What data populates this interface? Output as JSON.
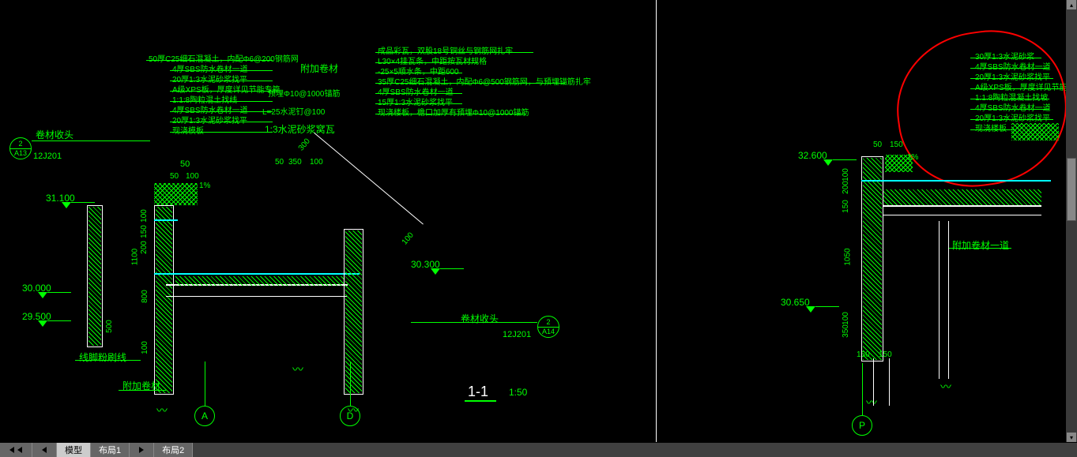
{
  "left": {
    "notes_top_left": [
      "50厚C25细石混凝土，内配Φ6@200钢筋网",
      "4厚SBS防水卷材一道",
      "20厚1:3水泥砂浆找平",
      "A级XPS板，厚度详见节能专篇",
      "1:1:8陶粒混土找线",
      "4厚SBS防水卷材一道",
      "20厚1:3水泥砂浆找平",
      "现浇模板"
    ],
    "notes_top_right": [
      "成品彩瓦，双股18号铜丝与钢筋网扎牢",
      "L30×4挂瓦条，中距按瓦材规格",
      "-25×5顺水条，中距600",
      "35厚C25细石混凝土，内配Φ6@500钢筋网，与预埋锚筋扎牢",
      "4厚SBS防水卷材一道",
      "15厚1:3水泥砂浆找平",
      "现浇楼板，檐口加厚有预埋Φ10@1000锚筋"
    ],
    "annotations": {
      "附加卷材": "附加卷材",
      "预埋": "预埋Φ10@1000锚筋",
      "水泥钉": "L=25水泥钉@100",
      "砂浆窝瓦": "1:3水泥砂浆窝瓦",
      "卷材收头L": "卷材收头",
      "卷材收头R": "卷材收头",
      "线脚粉刷线": "线脚粉刷线",
      "附加卷材B": "附加卷材"
    },
    "elevations": {
      "e1": "31.100",
      "e2": "30.000",
      "e3": "29.500",
      "e4": "30.300"
    },
    "dims": {
      "d50": "50",
      "d50b": "50",
      "d100": "100",
      "d100b": "100",
      "d100c": "100",
      "d100d": "100",
      "d150": "150",
      "d200": "200",
      "d300": "300",
      "d350": "350",
      "d1100": "1100",
      "d800": "800",
      "d500": "500",
      "d100e": "100",
      "slope": "1%"
    },
    "refs": {
      "leftRef": {
        "top": "2",
        "bot": "A13",
        "side": "12J201"
      },
      "rightRef": {
        "top": "2",
        "bot": "A14",
        "side": "12J201"
      }
    },
    "section": {
      "label": "1-1",
      "scale": "1:50"
    },
    "grids": {
      "A": "A",
      "D": "D"
    }
  },
  "right": {
    "notes": [
      "30厚1:3水泥砂浆",
      "4厚SBS防水卷材一道",
      "20厚1:3水泥砂浆找平",
      "A级XPS板，厚度详见节能专篇",
      "1:1:8陶粒混凝土找坡",
      "4厚SBS防水卷材一道",
      "20厚1:3水泥砂浆找平",
      "现浇楼板"
    ],
    "annotations": {
      "附加卷材一道": "附加卷材一道"
    },
    "elevations": {
      "e1": "32.600",
      "e2": "30.650"
    },
    "dims": {
      "d50": "50",
      "d150": "150",
      "d150b": "150",
      "d200": "200",
      "d100": "100",
      "d1050": "1050",
      "d100b": "100",
      "d350": "350",
      "d150c": "150",
      "d150d": "150",
      "slope": "1%"
    },
    "grids": {
      "P": "P"
    }
  },
  "tabs": {
    "model": "模型",
    "l1": "布局1",
    "l2": "布局2"
  }
}
